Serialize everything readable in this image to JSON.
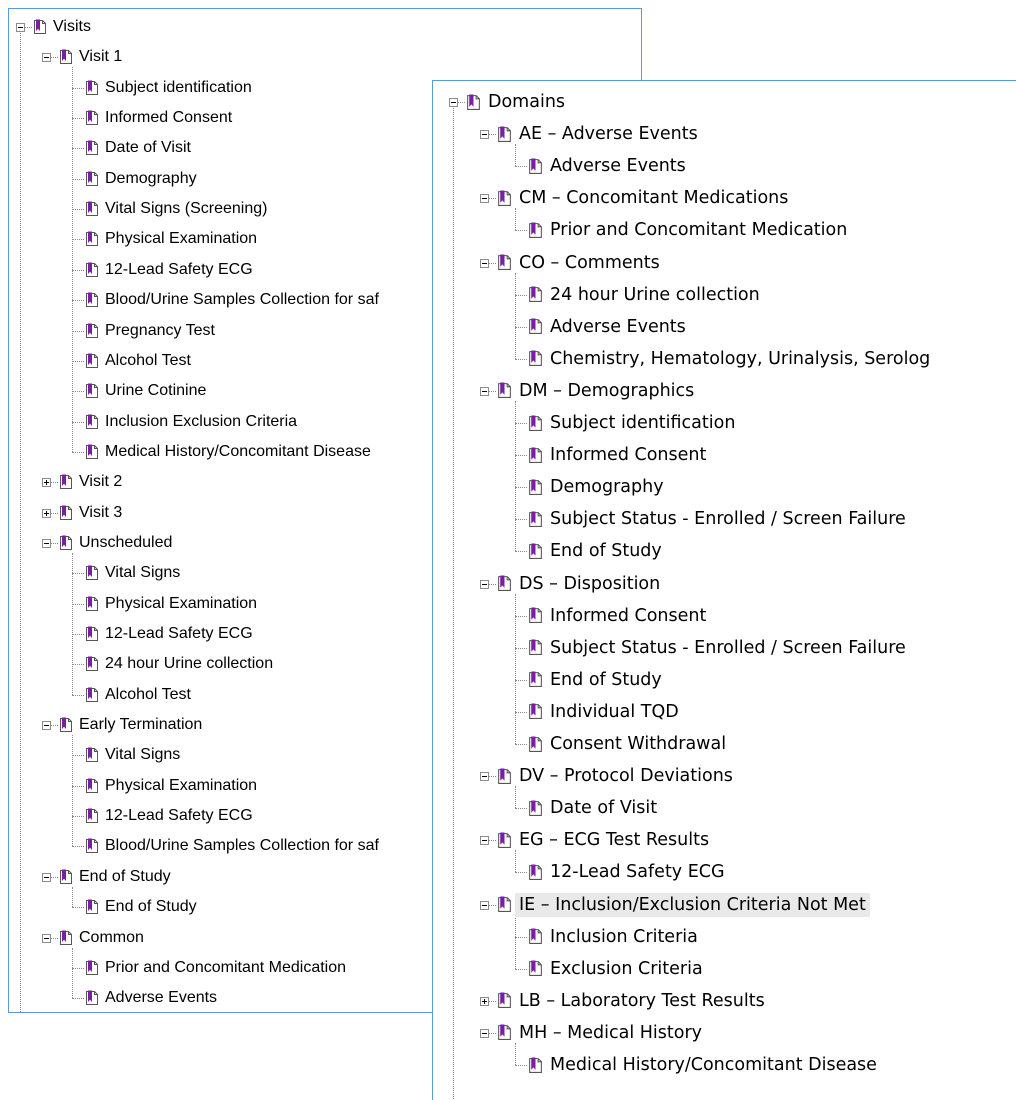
{
  "colors": {
    "icon_purple": "#7a1fa2",
    "panel_border": "#5b9bd5",
    "connector": "#8a8a8a",
    "highlight": "#e9e9e9"
  },
  "icons": {
    "node": "bookmark-page-icon",
    "expand": "plus-box-icon",
    "collapse": "minus-box-icon"
  },
  "visits_tree": [
    {
      "label": "Visits",
      "level": 0,
      "state": "expanded"
    },
    {
      "label": "Visit 1",
      "level": 1,
      "state": "expanded"
    },
    {
      "label": "Subject identification",
      "level": 2
    },
    {
      "label": "Informed Consent",
      "level": 2
    },
    {
      "label": "Date of Visit",
      "level": 2
    },
    {
      "label": "Demography",
      "level": 2
    },
    {
      "label": "Vital Signs (Screening)",
      "level": 2
    },
    {
      "label": "Physical Examination",
      "level": 2
    },
    {
      "label": "12-Lead Safety ECG",
      "level": 2
    },
    {
      "label": "Blood/Urine Samples Collection for saf",
      "level": 2
    },
    {
      "label": "Pregnancy Test",
      "level": 2
    },
    {
      "label": "Alcohol Test",
      "level": 2
    },
    {
      "label": "Urine Cotinine",
      "level": 2
    },
    {
      "label": "Inclusion Exclusion Criteria",
      "level": 2
    },
    {
      "label": "Medical History/Concomitant Disease",
      "level": 2
    },
    {
      "label": "Visit 2",
      "level": 1,
      "state": "collapsed"
    },
    {
      "label": "Visit 3",
      "level": 1,
      "state": "collapsed"
    },
    {
      "label": "Unscheduled",
      "level": 1,
      "state": "expanded"
    },
    {
      "label": "Vital Signs",
      "level": 2
    },
    {
      "label": "Physical Examination",
      "level": 2
    },
    {
      "label": "12-Lead Safety ECG",
      "level": 2
    },
    {
      "label": "24 hour Urine collection",
      "level": 2
    },
    {
      "label": "Alcohol Test",
      "level": 2
    },
    {
      "label": "Early Termination",
      "level": 1,
      "state": "expanded"
    },
    {
      "label": "Vital Signs",
      "level": 2
    },
    {
      "label": "Physical Examination",
      "level": 2
    },
    {
      "label": "12-Lead Safety ECG",
      "level": 2
    },
    {
      "label": "Blood/Urine Samples Collection for saf",
      "level": 2
    },
    {
      "label": "End of Study",
      "level": 1,
      "state": "expanded"
    },
    {
      "label": "End of Study",
      "level": 2
    },
    {
      "label": "Common",
      "level": 1,
      "state": "expanded"
    },
    {
      "label": "Prior and Concomitant Medication",
      "level": 2
    },
    {
      "label": "Adverse Events",
      "level": 2
    }
  ],
  "domains_tree": [
    {
      "label": "Domains",
      "level": 0,
      "state": "expanded"
    },
    {
      "label": "AE – Adverse Events",
      "level": 1,
      "state": "expanded"
    },
    {
      "label": "Adverse Events",
      "level": 2
    },
    {
      "label": "CM – Concomitant Medications",
      "level": 1,
      "state": "expanded"
    },
    {
      "label": "Prior and Concomitant Medication",
      "level": 2
    },
    {
      "label": "CO – Comments",
      "level": 1,
      "state": "expanded"
    },
    {
      "label": "24 hour Urine collection",
      "level": 2
    },
    {
      "label": "Adverse Events",
      "level": 2
    },
    {
      "label": "Chemistry, Hematology, Urinalysis, Serolog",
      "level": 2
    },
    {
      "label": "DM – Demographics",
      "level": 1,
      "state": "expanded"
    },
    {
      "label": "Subject identification",
      "level": 2
    },
    {
      "label": "Informed Consent",
      "level": 2
    },
    {
      "label": "Demography",
      "level": 2
    },
    {
      "label": "Subject Status - Enrolled / Screen Failure",
      "level": 2
    },
    {
      "label": "End of Study",
      "level": 2
    },
    {
      "label": "DS – Disposition",
      "level": 1,
      "state": "expanded"
    },
    {
      "label": "Informed Consent",
      "level": 2
    },
    {
      "label": "Subject Status - Enrolled / Screen Failure",
      "level": 2
    },
    {
      "label": "End of Study",
      "level": 2
    },
    {
      "label": "Individual TQD",
      "level": 2
    },
    {
      "label": "Consent Withdrawal",
      "level": 2
    },
    {
      "label": "DV – Protocol Deviations",
      "level": 1,
      "state": "expanded"
    },
    {
      "label": "Date of Visit",
      "level": 2
    },
    {
      "label": "EG – ECG Test Results",
      "level": 1,
      "state": "expanded"
    },
    {
      "label": "12-Lead Safety ECG",
      "level": 2
    },
    {
      "label": "IE – Inclusion/Exclusion Criteria Not Met",
      "level": 1,
      "state": "expanded",
      "selected": true
    },
    {
      "label": "Inclusion Criteria",
      "level": 2
    },
    {
      "label": "Exclusion Criteria",
      "level": 2
    },
    {
      "label": "LB – Laboratory Test Results",
      "level": 1,
      "state": "collapsed"
    },
    {
      "label": "MH – Medical History",
      "level": 1,
      "state": "expanded"
    },
    {
      "label": "Medical History/Concomitant Disease",
      "level": 2
    }
  ]
}
